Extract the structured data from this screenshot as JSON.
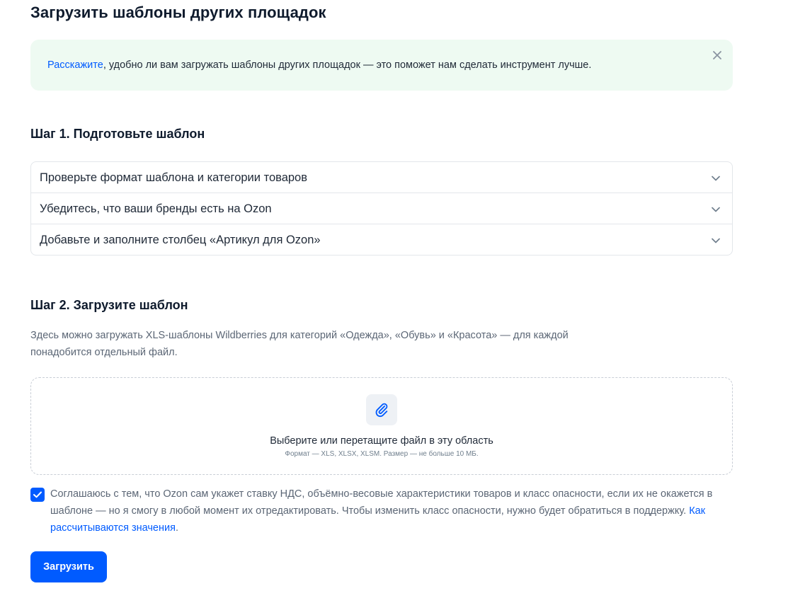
{
  "page": {
    "title": "Загрузить шаблоны других площадок"
  },
  "banner": {
    "link_text": "Расскажите",
    "text": ", удобно ли вам загружать шаблоны других площадок — это поможет нам сделать инструмент лучше.",
    "close_icon": "close-icon"
  },
  "step1": {
    "title": "Шаг 1. Подготовьте шаблон",
    "items": [
      {
        "label": "Проверьте формат шаблона и категории товаров"
      },
      {
        "label": "Убедитесь, что ваши бренды есть на Ozon"
      },
      {
        "label": "Добавьте и заполните столбец «Артикул для Ozon»"
      }
    ]
  },
  "step2": {
    "title": "Шаг 2. Загрузите шаблон",
    "description": "Здесь можно загружать XLS-шаблоны Wildberries для категорий «Одежда», «Обувь» и «Красота» — для каждой понадобится отдельный файл.",
    "dropzone": {
      "icon": "paperclip-icon",
      "main_text": "Выберите или перетащите файл в эту область",
      "hint": "Формат — XLS, XLSX, XLSM. Размер — не больше 10 МБ."
    }
  },
  "agreement": {
    "checked": true,
    "text": "Соглашаюсь с тем, что Ozon сам укажет ставку НДС, объёмно-весовые характеристики товаров и класс опасности, если их не окажется в шаблоне — но я смогу в любой момент их отредактировать. Чтобы изменить класс опасности, нужно будет обратиться в поддержку. ",
    "link_text": "Как рассчитываются значения",
    "suffix": "."
  },
  "submit": {
    "label": "Загрузить"
  },
  "colors": {
    "accent": "#005bff",
    "banner_bg": "#eefaf2",
    "muted_text": "#5b6675",
    "border": "#e3e6ea"
  }
}
